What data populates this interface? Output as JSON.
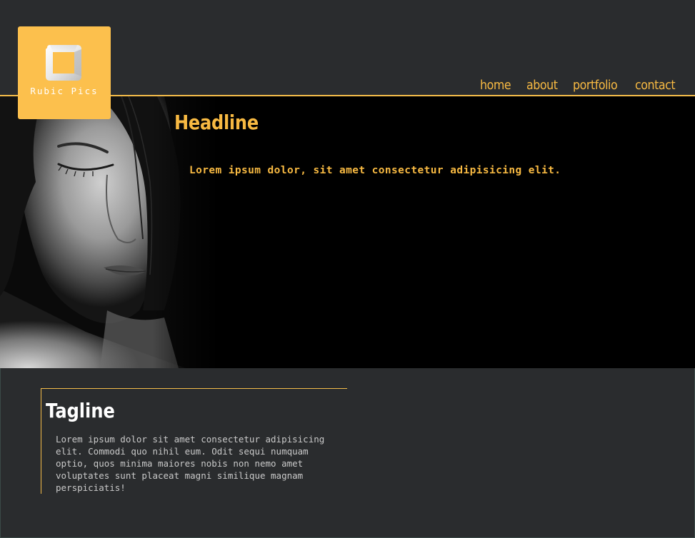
{
  "site": {
    "logo_text": "Rubic Pics",
    "logo_icon": "square-frame-icon"
  },
  "nav": {
    "items": [
      {
        "label": "home"
      },
      {
        "label": "about"
      },
      {
        "label": "portfolio"
      },
      {
        "label": "contact"
      }
    ]
  },
  "hero": {
    "headline": "Headline",
    "text": "Lorem ipsum dolor, sit amet consectetur adipisicing elit.",
    "image": "woman-portrait-photo"
  },
  "tagline": {
    "title": "Tagline",
    "text": "Lorem ipsum dolor sit amet consectetur adipisicing elit. Commodi quo nihil eum. Odit sequi numquam optio, quos minima maiores nobis non nemo amet voluptates sunt placeat magni similique magnam perspiciatis!"
  },
  "colors": {
    "background": "#2a2c2e",
    "accent": "#f7b942",
    "logo_bg": "#fcc04d",
    "hero_bg": "#000000"
  }
}
